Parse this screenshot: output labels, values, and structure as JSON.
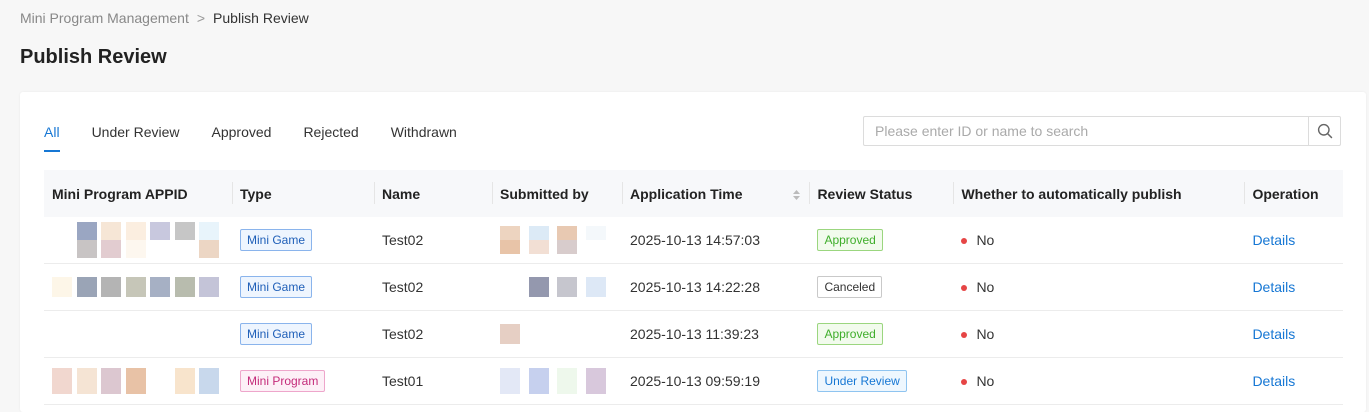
{
  "breadcrumb": {
    "parent": "Mini Program Management",
    "separator": ">",
    "current": "Publish Review"
  },
  "page_title": "Publish Review",
  "tabs": [
    {
      "label": "All",
      "active": true
    },
    {
      "label": "Under Review",
      "active": false
    },
    {
      "label": "Approved",
      "active": false
    },
    {
      "label": "Rejected",
      "active": false
    },
    {
      "label": "Withdrawn",
      "active": false
    }
  ],
  "search": {
    "placeholder": "Please enter ID or name to search",
    "value": "",
    "icon": "search-icon"
  },
  "table": {
    "columns": [
      "Mini Program APPID",
      "Type",
      "Name",
      "Submitted by",
      "Application Time",
      "Review Status",
      "Whether to automatically publish",
      "Operation"
    ],
    "sortable_column_icon": "sort-icon",
    "rows": [
      {
        "type": "Mini Game",
        "name": "Test02",
        "time": "2025-10-13 14:57:03",
        "status": "Approved",
        "auto_publish": "No",
        "operation": "Details"
      },
      {
        "type": "Mini Game",
        "name": "Test02",
        "time": "2025-10-13 14:22:28",
        "status": "Canceled",
        "auto_publish": "No",
        "operation": "Details"
      },
      {
        "type": "Mini Game",
        "name": "Test02",
        "time": "2025-10-13 11:39:23",
        "status": "Approved",
        "auto_publish": "No",
        "operation": "Details"
      },
      {
        "type": "Mini Program",
        "name": "Test01",
        "time": "2025-10-13 09:59:19",
        "status": "Under Review",
        "auto_publish": "No",
        "operation": "Details"
      }
    ]
  },
  "colors": {
    "accent": "#1677d4",
    "approved": "#3fae2b",
    "no_dot": "#e64545",
    "mini_program_tag": "#c42b7a"
  }
}
